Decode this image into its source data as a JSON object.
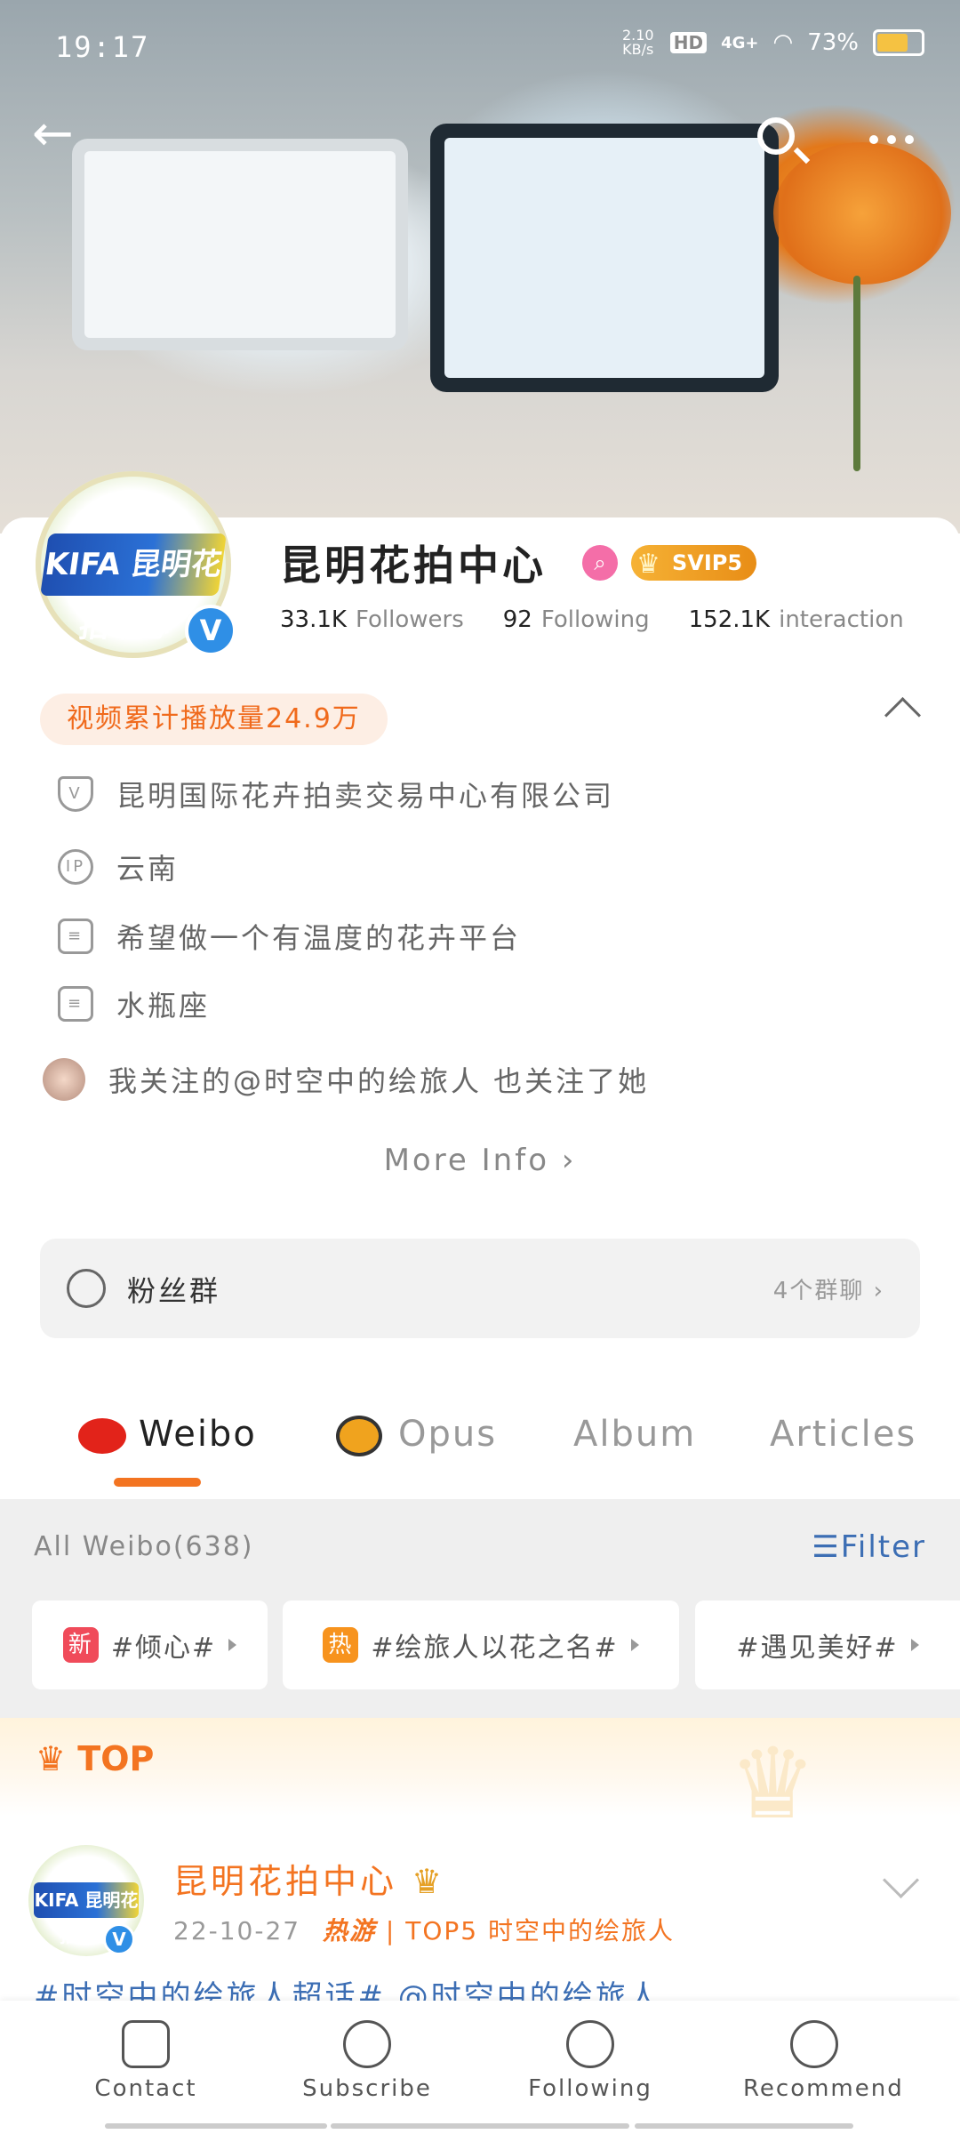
{
  "status": {
    "time": "19:17",
    "speed": "2.10 KB/s",
    "hd": "HD",
    "network": "4G+",
    "battery": "73%"
  },
  "header": {
    "back_icon": "arrow-left",
    "search_icon": "search",
    "more_icon": "more-dots"
  },
  "profile": {
    "name": "昆明花拍中心",
    "logo_text": "KIFA 昆明花拍中心",
    "verified": "V",
    "svip": "SVIP5",
    "followers_value": "33.1K",
    "followers_label": "Followers",
    "following_value": "92",
    "following_label": "Following",
    "interaction_value": "152.1K",
    "interaction_label": "interaction",
    "play_count": "视频累计播放量24.9万"
  },
  "info": {
    "company": "昆明国际花卉拍卖交易中心有限公司",
    "ip_icon": "IP",
    "ip": "云南",
    "bio": "希望做一个有温度的花卉平台",
    "zodiac": "水瓶座",
    "mutual": "我关注的@时空中的绘旅人 也关注了她",
    "more": "More Info"
  },
  "fans_group": {
    "label": "粉丝群",
    "count": "4个群聊"
  },
  "tabs": [
    "Weibo",
    "Opus",
    "Album",
    "Articles"
  ],
  "feed": {
    "all_label": "All Weibo(638)",
    "filter_label": "Filter",
    "chips": [
      {
        "badge": "新",
        "text": "#倾心#"
      },
      {
        "badge": "热",
        "text": "#绘旅人以花之名#"
      },
      {
        "badge": "",
        "text": "#遇见美好#"
      }
    ],
    "top_label": "TOP"
  },
  "post": {
    "author": "昆明花拍中心",
    "date": "22-10-27",
    "hot_tag": "热游",
    "rank": "TOP5 时空中的绘旅人",
    "text": "#时空中的绘旅人超话# @时空中的绘旅人"
  },
  "bottom_nav": [
    "Contact",
    "Subscribe",
    "Following",
    "Recommend"
  ],
  "colors": {
    "accent": "#f37421",
    "link": "#3c6eb4",
    "svip": "#f6b235"
  }
}
